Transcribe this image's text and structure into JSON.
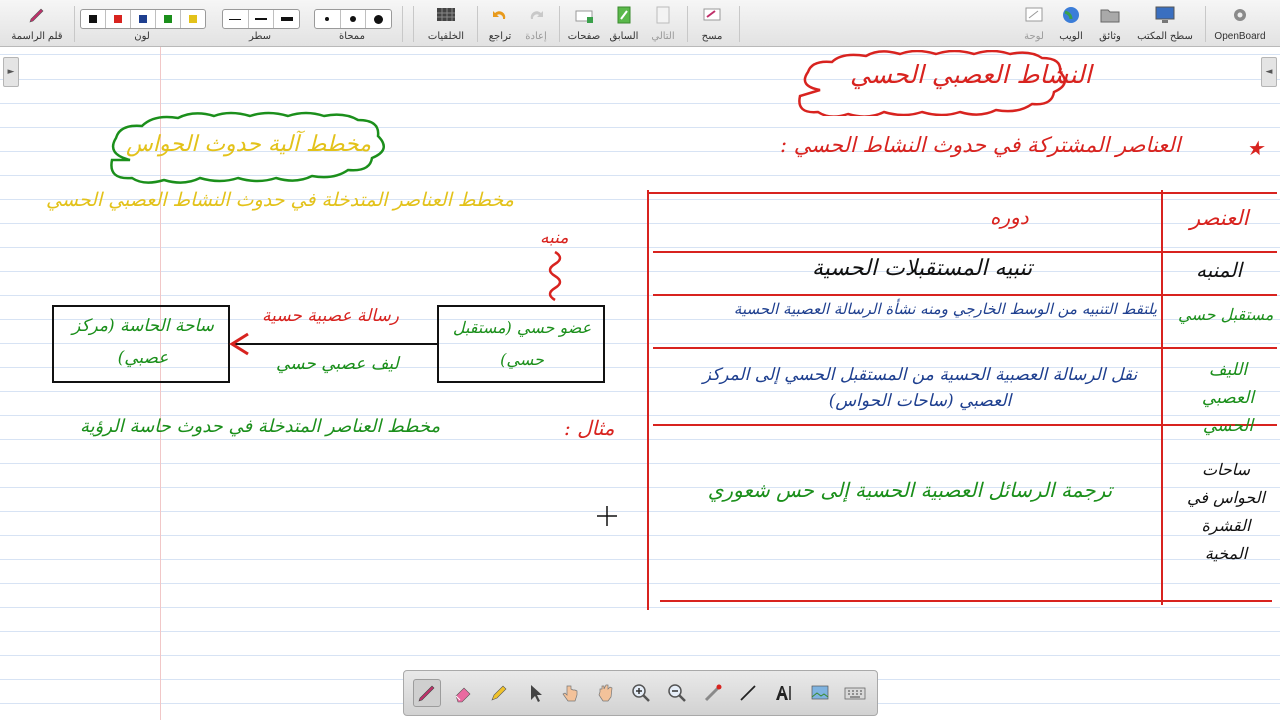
{
  "toolbar": {
    "app_name": "OpenBoard",
    "desktop": "سطح المكتب",
    "documents": "وثائق",
    "web": "الويب",
    "board": "لوحة",
    "erase": "مسح",
    "previous": "السابق",
    "next": "التالي",
    "pages": "صفحات",
    "undo": "تراجع",
    "redo": "إعادة",
    "backgrounds": "الخلفيات",
    "eraser_size": "ممحاة",
    "line_width": "سطر",
    "color": "لون",
    "pen": "قلم الراسمة"
  },
  "colors": {
    "palette": [
      "#111111",
      "#d8231f",
      "#1e3f8f",
      "#1b8f1b",
      "#e3c21a"
    ],
    "red": "#d8231f",
    "green": "#1b8f1b",
    "blue": "#1e3f8f",
    "yellow": "#e3c21a"
  },
  "board": {
    "title": "النشاط العصبي الحسي",
    "subtitle": "العناصر المشتركة في حدوث النشاط الحسي :",
    "table": {
      "header_element": "العنصر",
      "header_role": "دوره",
      "rows": [
        {
          "element": "المنبه",
          "role": "تنبيه المستقبلات الحسية"
        },
        {
          "element": "مستقبل حسي",
          "role": "يلتقط التنبيه من الوسط الخارجي ومنه نشأة الرسالة العصبية الحسية"
        },
        {
          "element": "الليف العصبي الحسي",
          "role": "نقل الرسالة العصبية الحسية من المستقبل الحسي إلى المركز العصبي (ساحات الحواس)"
        },
        {
          "element": "ساحات الحواس في القشرة المخية",
          "role": "ترجمة الرسائل العصبية الحسية إلى حس شعوري"
        }
      ]
    },
    "diagram": {
      "cloud_title": "مخطط آلية حدوث الحواس",
      "yellow_text": "مخطط العناصر المتدخلة في حدوث النشاط العصبي الحسي",
      "stimulus_label": "منبه",
      "left_box": "ساحة الحاسة (مركز عصبي)",
      "right_box": "عضو حسي (مستقبل حسي)",
      "arrow_top": "رسالة عصبية حسية",
      "arrow_bottom": "ليف عصبي حسي"
    },
    "example_label": "مثال :",
    "example_text": "مخطط العناصر المتدخلة في حدوث حاسة الرؤية"
  },
  "bottom_tools": [
    "pen-icon",
    "eraser-icon",
    "marker-icon",
    "pointer-icon",
    "hand-pointer-icon",
    "grab-hand-icon",
    "zoom-in-icon",
    "zoom-out-icon",
    "laser-pointer-icon",
    "line-icon",
    "text-icon",
    "capture-icon",
    "keyboard-icon"
  ]
}
